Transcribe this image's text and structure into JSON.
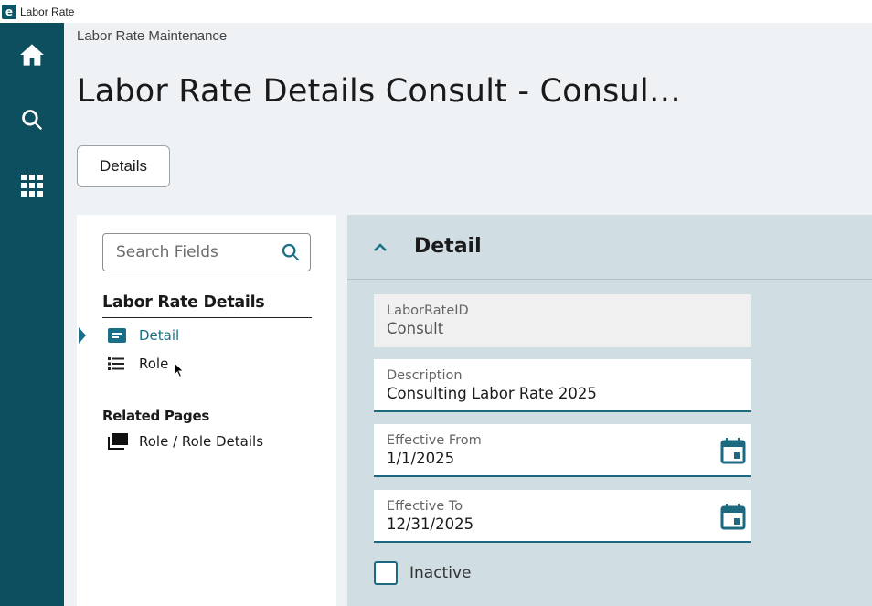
{
  "window": {
    "title": "Labor Rate",
    "logo_letter": "e"
  },
  "rail": {
    "items": [
      {
        "icon": "home-icon"
      },
      {
        "icon": "search-icon"
      },
      {
        "icon": "apps-grid-icon"
      }
    ]
  },
  "header": {
    "breadcrumb": "Labor Rate Maintenance",
    "title": "Labor Rate Details Consult - Consul…",
    "details_button": "Details"
  },
  "left_panel": {
    "search_placeholder": "Search Fields",
    "section_title": "Labor Rate Details",
    "items": [
      {
        "label": "Detail",
        "icon": "card-icon",
        "active": true
      },
      {
        "label": "Role",
        "icon": "list-icon",
        "active": false
      }
    ],
    "related_title": "Related Pages",
    "related_items": [
      {
        "label": "Role / Role Details",
        "icon": "pages-icon"
      }
    ]
  },
  "detail": {
    "title": "Detail",
    "fields": [
      {
        "label": "LaborRateID",
        "value": "Consult",
        "readonly": true
      },
      {
        "label": "Description",
        "value": "Consulting Labor Rate 2025",
        "readonly": false
      },
      {
        "label": "Effective From",
        "value": "1/1/2025",
        "readonly": false,
        "icon": "calendar-icon"
      },
      {
        "label": "Effective To",
        "value": "12/31/2025",
        "readonly": false,
        "icon": "calendar-icon"
      }
    ],
    "inactive_label": "Inactive",
    "inactive_checked": false
  },
  "colors": {
    "rail": "#0d4f5f",
    "accent": "#1a6f86",
    "detail_bg": "#d0dde2"
  }
}
